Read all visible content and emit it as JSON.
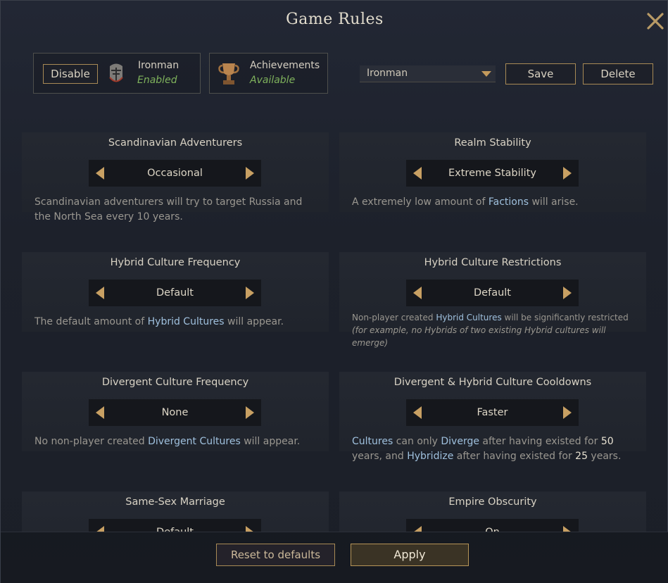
{
  "window": {
    "title": "Game Rules",
    "close_icon": "close-icon"
  },
  "topbar": {
    "disable_label": "Disable",
    "ironman_label": "Ironman",
    "ironman_status": "Enabled",
    "achievements_label": "Achievements",
    "achievements_status": "Available",
    "preset_value": "Ironman",
    "save_label": "Save",
    "delete_label": "Delete"
  },
  "rules": [
    {
      "title": "Scandinavian Adventurers",
      "value": "Occasional"
    },
    {
      "title": "Realm Stability",
      "value": "Extreme Stability"
    },
    {
      "title": "Hybrid Culture Frequency",
      "value": "Default"
    },
    {
      "title": "Hybrid Culture Restrictions",
      "value": "Default"
    },
    {
      "title": "Divergent Culture Frequency",
      "value": "None"
    },
    {
      "title": "Divergent & Hybrid Culture Cooldowns",
      "value": "Faster"
    },
    {
      "title": "Same-Sex Marriage",
      "value": "Default"
    },
    {
      "title": "Empire Obscurity",
      "value": "On"
    }
  ],
  "descriptions": {
    "scandinavian": "Scandinavian adventurers will try to target Russia and the North Sea every 10 years.",
    "realm_a": "A extremely low amount of ",
    "realm_link": "Factions",
    "realm_b": " will arise.",
    "hybrid_freq_a": "The default amount of ",
    "hybrid_freq_link": "Hybrid Cultures",
    "hybrid_freq_b": " will appear.",
    "hybrid_restr_a": "Non-player created ",
    "hybrid_restr_link": "Hybrid Cultures",
    "hybrid_restr_b": " will be significantly restricted ",
    "hybrid_restr_c": "(for example, no Hybrids of two existing Hybrid cultures will emerge)",
    "divergent_a": "No non-player created ",
    "divergent_link": "Divergent Cultures",
    "divergent_b": " will appear.",
    "cooldown_link1": "Cultures",
    "cooldown_a": " can only ",
    "cooldown_link2": "Diverge",
    "cooldown_b": " after having existed for ",
    "cooldown_n1": "50",
    "cooldown_c": " years, and ",
    "cooldown_link3": "Hybridize",
    "cooldown_d": " after having existed for ",
    "cooldown_n2": "25",
    "cooldown_e": " years."
  },
  "bottom": {
    "reset_label": "Reset to defaults",
    "apply_label": "Apply"
  },
  "colors": {
    "accent_gold": "#a88a55",
    "link_blue": "#9fc0dd",
    "status_green": "#7fb25c"
  }
}
